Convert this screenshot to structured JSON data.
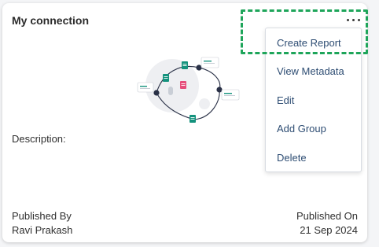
{
  "card": {
    "title": "My connection",
    "description_label": "Description:",
    "published_by_label": "Published By",
    "published_by_value": "Ravi Prakash",
    "published_on_label": "Published On",
    "published_on_value": "21 Sep 2024"
  },
  "menu": {
    "items": [
      {
        "label": "Create Report"
      },
      {
        "label": "View Metadata"
      },
      {
        "label": "Edit"
      },
      {
        "label": "Add Group"
      },
      {
        "label": "Delete"
      }
    ]
  },
  "colors": {
    "accent_green": "#1ea55a",
    "menu_text": "#2e4d73",
    "illustration_teal": "#14927d",
    "illustration_pink": "#e64c7a",
    "node_dark": "#2a3147"
  },
  "icons": {
    "more_options": "ellipsis-icon",
    "illustration": "data-connection-illustration"
  }
}
